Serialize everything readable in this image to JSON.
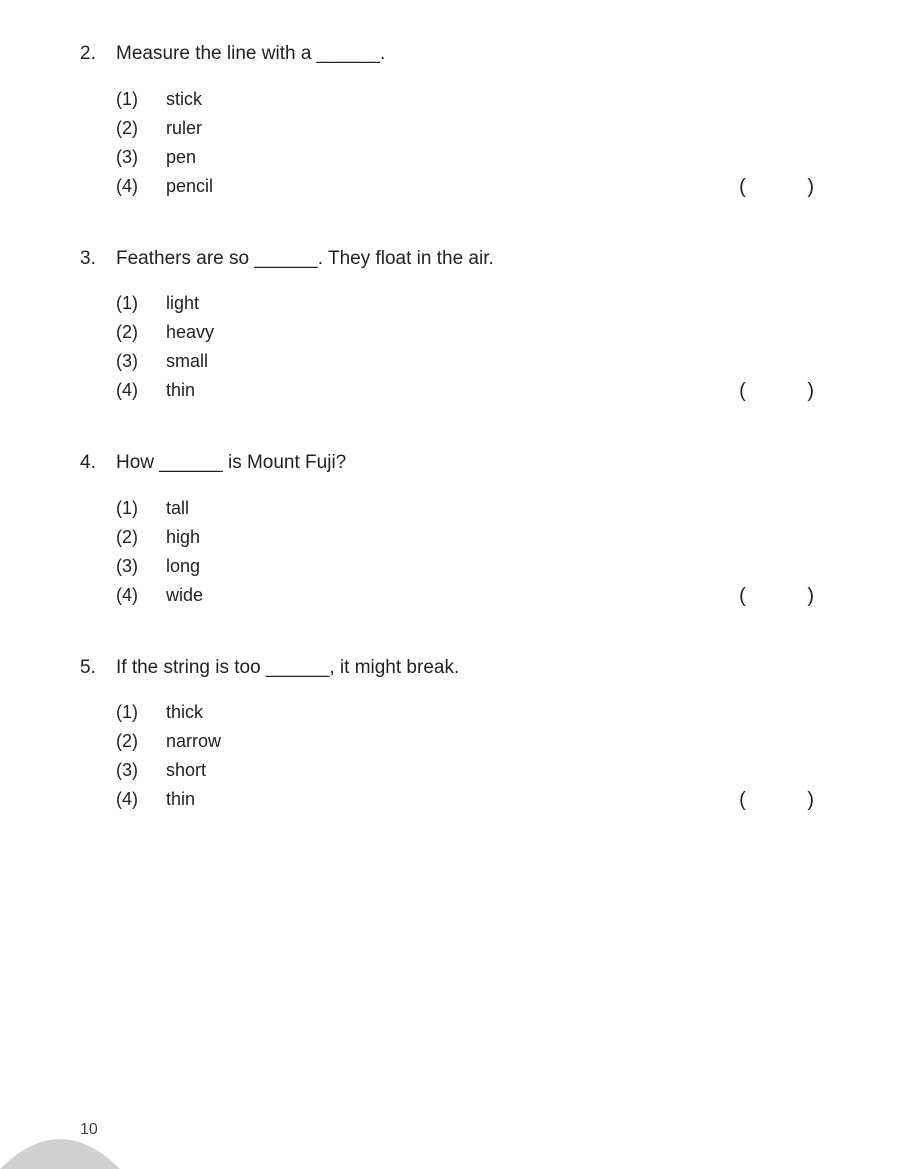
{
  "page": {
    "number": "10",
    "questions": [
      {
        "id": "q2",
        "number": "2.",
        "stem": "Measure the line with a ______.",
        "options": [
          {
            "num": "(1)",
            "text": "stick"
          },
          {
            "num": "(2)",
            "text": "ruler"
          },
          {
            "num": "(3)",
            "text": "pen"
          },
          {
            "num": "(4)",
            "text": "pencil"
          }
        ]
      },
      {
        "id": "q3",
        "number": "3.",
        "stem": "Feathers are so ______. They float in the air.",
        "options": [
          {
            "num": "(1)",
            "text": "light"
          },
          {
            "num": "(2)",
            "text": "heavy"
          },
          {
            "num": "(3)",
            "text": "small"
          },
          {
            "num": "(4)",
            "text": "thin"
          }
        ]
      },
      {
        "id": "q4",
        "number": "4.",
        "stem": "How ______ is Mount Fuji?",
        "options": [
          {
            "num": "(1)",
            "text": "tall"
          },
          {
            "num": "(2)",
            "text": "high"
          },
          {
            "num": "(3)",
            "text": "long"
          },
          {
            "num": "(4)",
            "text": "wide"
          }
        ]
      },
      {
        "id": "q5",
        "number": "5.",
        "stem": "If the string is too ______, it might break.",
        "options": [
          {
            "num": "(1)",
            "text": "thick"
          },
          {
            "num": "(2)",
            "text": "narrow"
          },
          {
            "num": "(3)",
            "text": "short"
          },
          {
            "num": "(4)",
            "text": "thin"
          }
        ]
      }
    ]
  }
}
